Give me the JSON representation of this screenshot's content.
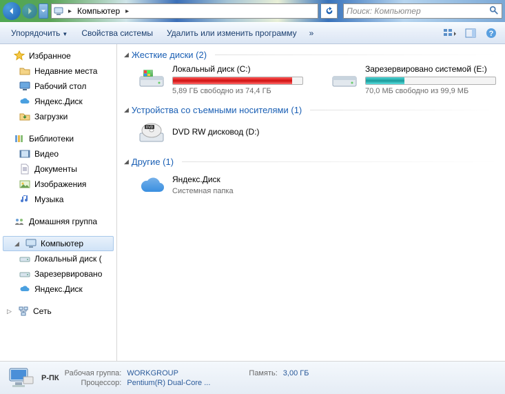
{
  "address": {
    "location": "Компьютер"
  },
  "search": {
    "placeholder": "Поиск: Компьютер"
  },
  "toolbar": {
    "organize": "Упорядочить",
    "sys_props": "Свойства системы",
    "uninstall": "Удалить или изменить программу",
    "chevrons": "»"
  },
  "sidebar": {
    "favorites": {
      "label": "Избранное",
      "items": [
        "Недавние места",
        "Рабочий стол",
        "Яндекс.Диск",
        "Загрузки"
      ]
    },
    "libraries": {
      "label": "Библиотеки",
      "items": [
        "Видео",
        "Документы",
        "Изображения",
        "Музыка"
      ]
    },
    "homegroup": {
      "label": "Домашняя группа"
    },
    "computer": {
      "label": "Компьютер",
      "items": [
        "Локальный диск (",
        "Зарезервировано",
        "Яндекс.Диск"
      ]
    },
    "network": {
      "label": "Сеть"
    }
  },
  "sections": {
    "hdd": {
      "title": "Жесткие диски (2)"
    },
    "remov": {
      "title": "Устройства со съемными носителями (1)"
    },
    "other": {
      "title": "Другие (1)"
    }
  },
  "drives": {
    "c": {
      "name": "Локальный диск (C:)",
      "sub": "5,89 ГБ свободно из 74,4 ГБ",
      "fill": 92
    },
    "e": {
      "name": "Зарезервировано системой (E:)",
      "sub": "70,0 МБ свободно из 99,9 МБ",
      "fill": 30
    },
    "dvd": {
      "name": "DVD RW дисковод (D:)"
    },
    "yd": {
      "name": "Яндекс.Диск",
      "sub": "Системная папка"
    }
  },
  "status": {
    "host": "Р-ПК",
    "wg_label": "Рабочая группа:",
    "wg": "WORKGROUP",
    "cpu_label": "Процессор:",
    "cpu": "Pentium(R) Dual-Core   ...",
    "mem_label": "Память:",
    "mem": "3,00 ГБ"
  }
}
